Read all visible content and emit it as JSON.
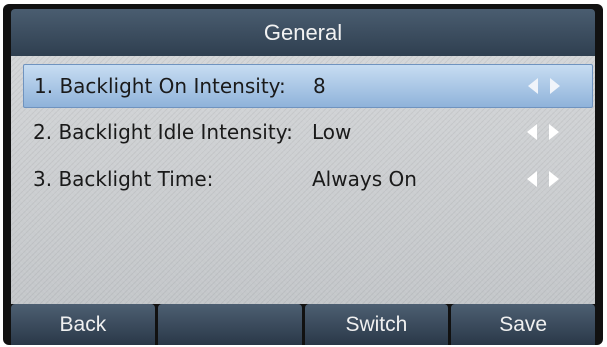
{
  "header": {
    "title": "General"
  },
  "rows": [
    {
      "label": "1. Backlight On Intensity:",
      "value": "8",
      "selected": true
    },
    {
      "label": "2. Backlight Idle Intensity:",
      "value": "Low",
      "selected": false
    },
    {
      "label": "3. Backlight Time:",
      "value": "Always On",
      "selected": false
    }
  ],
  "softkeys": [
    "Back",
    "",
    "Switch",
    "Save"
  ],
  "icons": {
    "left": "left-arrow-icon",
    "right": "right-arrow-icon"
  }
}
